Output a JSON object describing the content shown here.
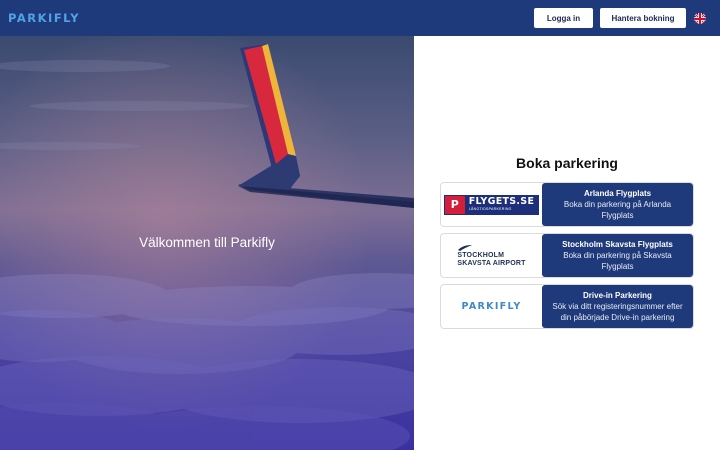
{
  "header": {
    "logo": "PARKIFLY",
    "login_label": "Logga in",
    "manage_label": "Hantera bokning",
    "language_icon": "uk-flag-icon"
  },
  "hero": {
    "title": "Välkommen till Parkifly"
  },
  "booking": {
    "title": "Boka parkering",
    "cards": [
      {
        "logo_text": "FLYGETS.SE",
        "logo_subtext": "LÅNGTIDSPARKERING",
        "logo_mark": "P",
        "title": "Arlanda Flygplats",
        "description": "Boka din parkering på Arlanda Flygplats"
      },
      {
        "logo_line1": "STOCKHOLM",
        "logo_line2": "SKAVSTA AIRPORT",
        "title": "Stockholm Skavsta Flygplats",
        "description": "Boka din parkering på Skavsta Flygplats"
      },
      {
        "logo_text": "PARKIFLY",
        "title": "Drive-in Parkering",
        "description": "Sök via ditt registeringsnummer efter din påbörjade Drive-in parkering"
      }
    ]
  },
  "colors": {
    "brand_navy": "#1f3a7a",
    "logo_blue": "#4fa3e6"
  }
}
